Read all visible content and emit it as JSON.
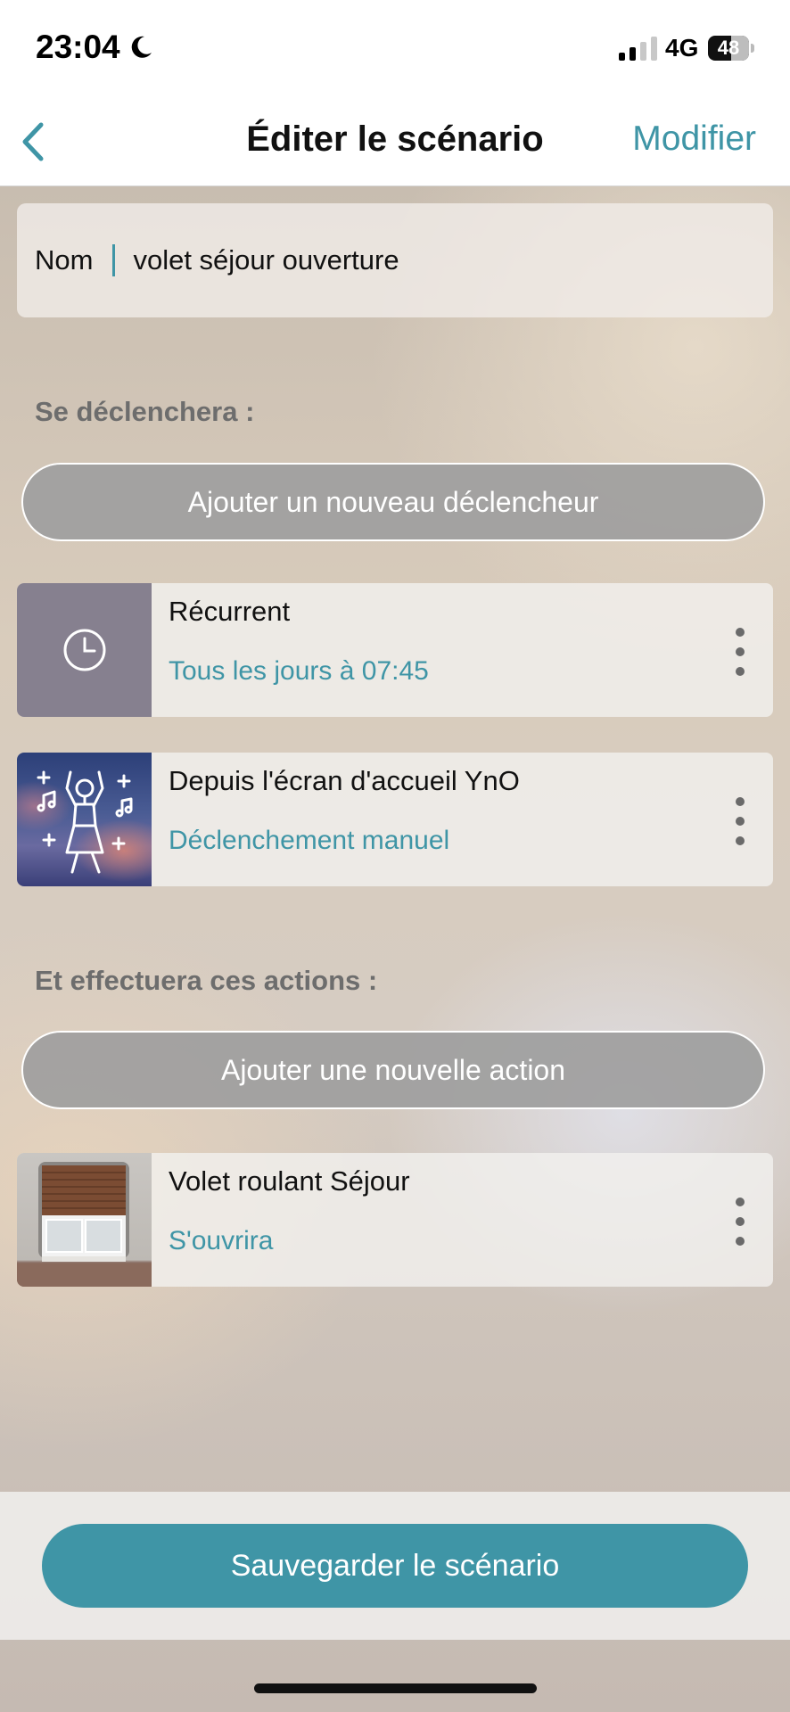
{
  "status_bar": {
    "time": "23:04",
    "network": "4G",
    "battery": "48"
  },
  "nav": {
    "title": "Éditer le scénario",
    "action": "Modifier"
  },
  "name_field": {
    "label": "Nom",
    "value": "volet séjour ouverture"
  },
  "triggers": {
    "section_label": "Se déclenchera :",
    "add_label": "Ajouter un nouveau déclencheur",
    "items": [
      {
        "title": "Récurrent",
        "subtitle": "Tous les jours à 07:45",
        "icon": "clock-icon"
      },
      {
        "title": "Depuis l'écran d'accueil YnO",
        "subtitle": "Déclenchement manuel",
        "icon": "dancing-person-icon"
      }
    ]
  },
  "actions": {
    "section_label": "Et effectuera ces actions :",
    "add_label": "Ajouter une nouvelle action",
    "items": [
      {
        "title": "Volet roulant Séjour",
        "subtitle": "S'ouvrira",
        "icon": "window-shutter-photo"
      }
    ]
  },
  "footer": {
    "save_label": "Sauvegarder le scénario"
  },
  "colors": {
    "accent": "#3f95a6",
    "pill_button": "#9e9e9e",
    "section_label": "#6d6d6d"
  }
}
